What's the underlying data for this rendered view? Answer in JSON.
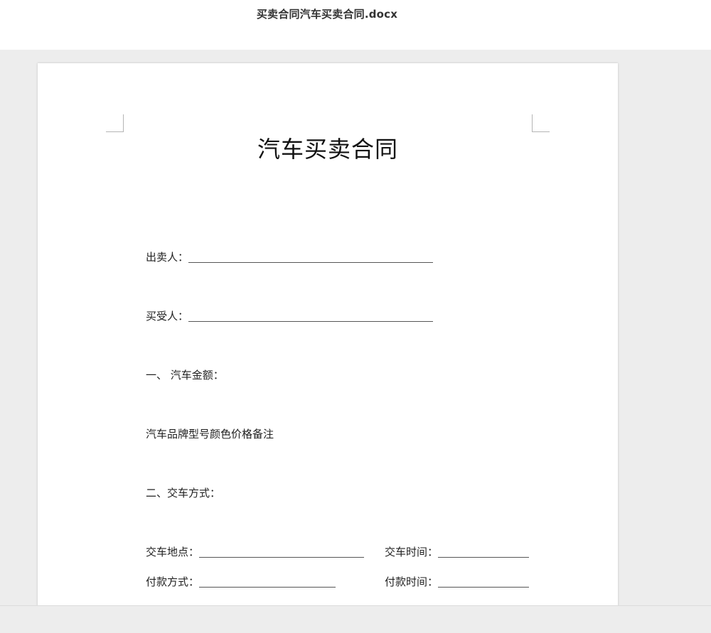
{
  "header": {
    "filename": "买卖合同汽车买卖合同.docx"
  },
  "document": {
    "title": "汽车买卖合同",
    "seller_label": "出卖人：",
    "buyer_label": "买受人：",
    "section1_heading": "一、 汽车金额：",
    "vehicle_columns_text": "汽车品牌型号颜色价格备注",
    "section2_heading": "二、交车方式：",
    "delivery_place_label": "交车地点：",
    "delivery_time_label": "交车时间：",
    "payment_method_label": "付款方式：",
    "payment_time_label": "付款时间："
  }
}
